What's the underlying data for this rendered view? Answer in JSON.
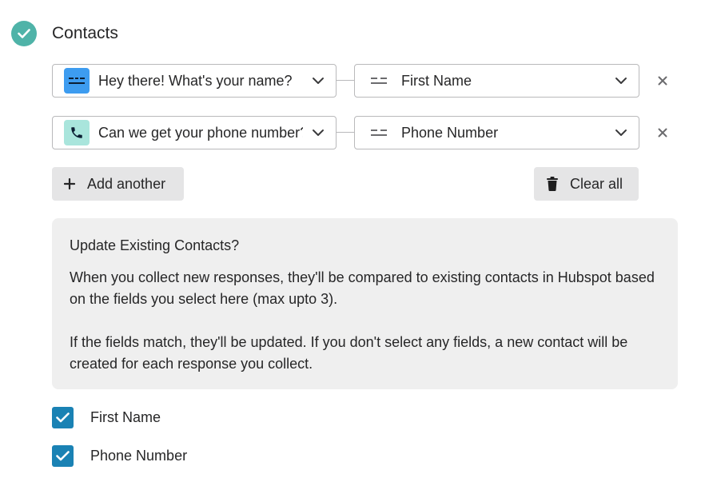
{
  "section": {
    "title": "Contacts",
    "accent_color": "#4fb3a8",
    "status_icon": "check-circle-icon"
  },
  "mappings": [
    {
      "question": "Hey there! What's your name?",
      "question_icon": "short-text-icon",
      "question_badge_color": "#3d9cf0",
      "field": "First Name",
      "field_icon": "text-field-icon"
    },
    {
      "question": "Can we get your phone number?",
      "question_icon": "phone-icon",
      "question_badge_color": "#a9e5dc",
      "field": "Phone Number",
      "field_icon": "text-field-icon"
    }
  ],
  "actions": {
    "add_label": "Add another",
    "clear_label": "Clear all"
  },
  "info": {
    "title": "Update Existing Contacts?",
    "paragraph1": "When you collect new responses, they'll be compared to existing contacts in Hubspot based on the fields you select here (max upto 3).",
    "paragraph2": "If the fields match, they'll be updated. If you don't select any fields, a new contact will be created for each response you collect."
  },
  "match_fields": [
    {
      "label": "First Name",
      "checked": true
    },
    {
      "label": "Phone Number",
      "checked": true
    }
  ],
  "colors": {
    "checkbox": "#1a82b4",
    "info_bg": "#efefef",
    "button_bg": "#e5e5e6",
    "border": "#b9b9bb"
  }
}
